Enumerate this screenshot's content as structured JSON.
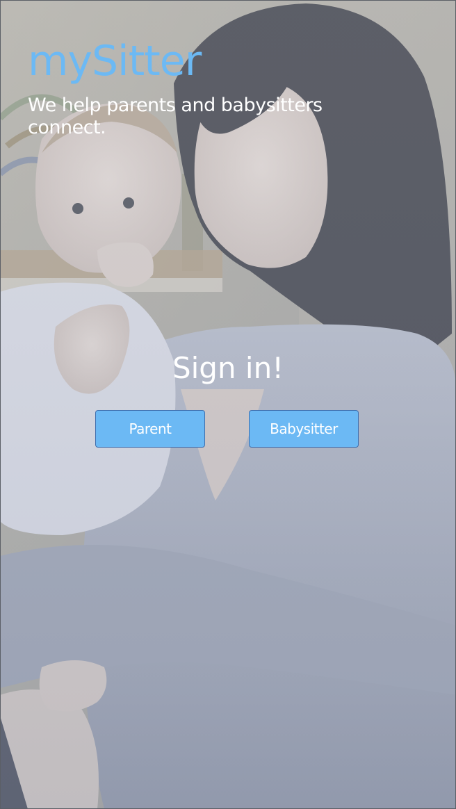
{
  "app": {
    "brand": "mySitter",
    "tagline": "We help parents and babysitters connect."
  },
  "signin": {
    "title": "Sign in!",
    "buttons": {
      "parent_label": "Parent",
      "babysitter_label": "Babysitter"
    }
  },
  "colors": {
    "brand": "#6cb9f4",
    "button_fill": "#6cb9f4",
    "button_border": "#3f6fae",
    "text_light": "#ffffff"
  }
}
